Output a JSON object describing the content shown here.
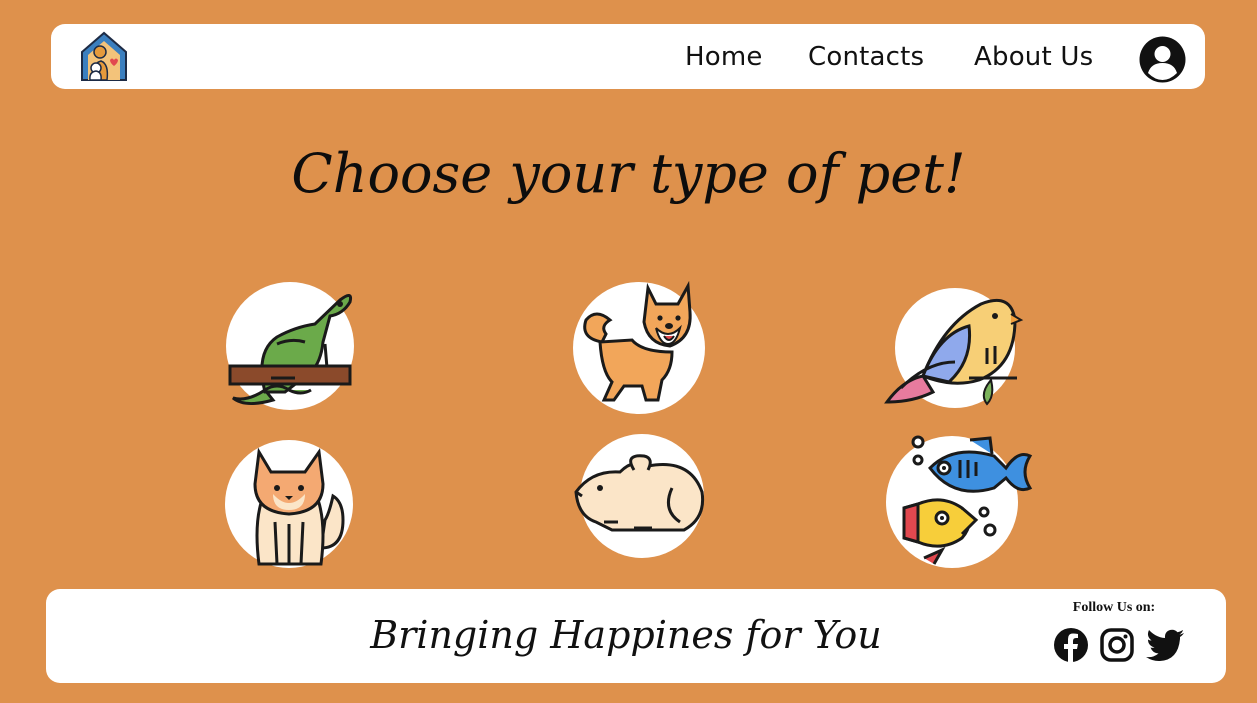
{
  "nav": {
    "logo_icon": "pet-house-logo-icon",
    "links": [
      {
        "label": "Home"
      },
      {
        "label": "Contacts"
      },
      {
        "label": "About Us"
      }
    ],
    "profile_icon": "user-circle-icon"
  },
  "main": {
    "title": "Choose your type of pet!",
    "pets": [
      {
        "icon": "lizard-icon"
      },
      {
        "icon": "dog-icon"
      },
      {
        "icon": "bird-icon"
      },
      {
        "icon": "cat-icon"
      },
      {
        "icon": "mouse-icon"
      },
      {
        "icon": "fish-icon"
      }
    ]
  },
  "footer": {
    "tagline": "Bringing Happines for You",
    "follow_label": "Follow Us on:",
    "social": [
      {
        "icon": "facebook-icon"
      },
      {
        "icon": "instagram-icon"
      },
      {
        "icon": "twitter-icon"
      }
    ]
  },
  "colors": {
    "background": "#DE914C",
    "panel": "#FFFFFF",
    "circle": "#FFFFFF"
  }
}
